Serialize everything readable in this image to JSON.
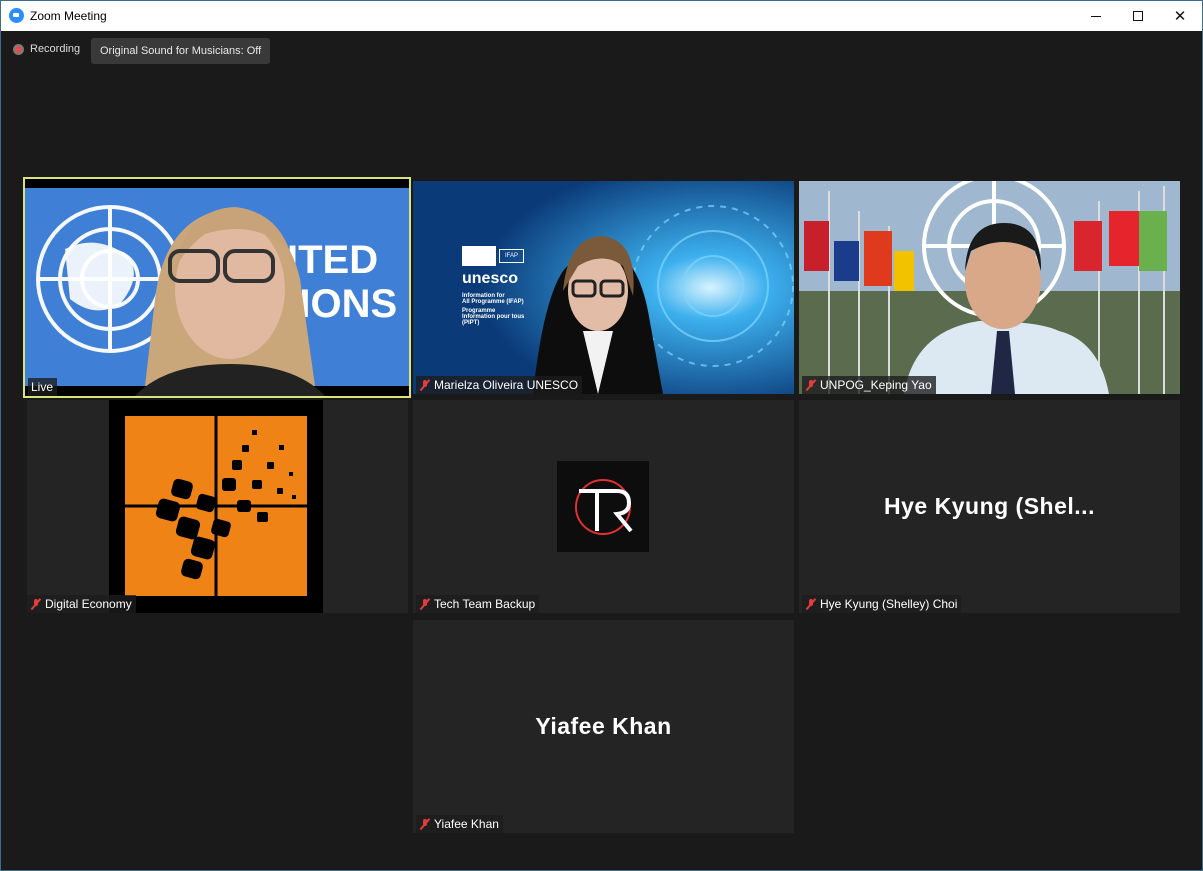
{
  "window": {
    "title": "Zoom Meeting"
  },
  "recording": {
    "label": "Recording"
  },
  "sound_button": {
    "label": "Original Sound for Musicians: Off"
  },
  "tiles": [
    {
      "name": "Live",
      "muted": false,
      "active": true
    },
    {
      "name": "Marielza Oliveira UNESCO",
      "muted": true,
      "backdrop_text": {
        "logo": "unesco",
        "line1": "Information for",
        "line2": "All Programme (IFAP)",
        "line3": "Programme",
        "line4": "Information pour tous",
        "line5": "(PIPT)",
        "badge": "IFAP"
      }
    },
    {
      "name": "UNPOG_Keping Yao",
      "muted": true
    },
    {
      "name": "Digital Economy",
      "muted": true
    },
    {
      "name": "Tech Team Backup",
      "muted": true
    },
    {
      "name": "Hye Kyung (Shelley) Choi",
      "muted": true,
      "display_text": "Hye  Kyung  (Shel..."
    },
    {
      "name": "Yiafee Khan",
      "muted": true,
      "display_text": "Yiafee Khan"
    }
  ],
  "slide_text": {
    "line1": "ITED",
    "line2": "TIONS"
  },
  "colors": {
    "active_border": "#d8e37b",
    "mic_off": "#e23d3d",
    "accent": "#2d8cff"
  }
}
